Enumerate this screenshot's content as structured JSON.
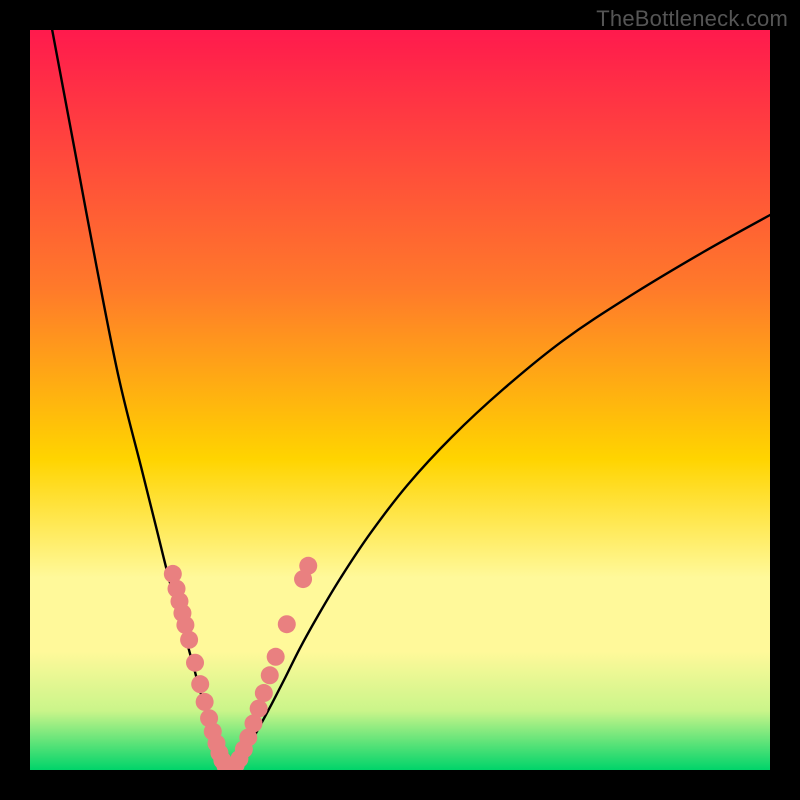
{
  "watermark": "TheBottleneck.com",
  "chart_data": {
    "type": "line",
    "title": "",
    "xlabel": "",
    "ylabel": "",
    "xlim": [
      0,
      100
    ],
    "ylim": [
      0,
      100
    ],
    "gradient_stops": [
      {
        "offset": 0,
        "color": "#ff1a4d"
      },
      {
        "offset": 35,
        "color": "#ff7a2a"
      },
      {
        "offset": 58,
        "color": "#ffd400"
      },
      {
        "offset": 74,
        "color": "#fff99a"
      },
      {
        "offset": 84,
        "color": "#fff99a"
      },
      {
        "offset": 92,
        "color": "#caf58a"
      },
      {
        "offset": 100,
        "color": "#00d46a"
      }
    ],
    "series": [
      {
        "name": "left-branch",
        "x": [
          3,
          6,
          9,
          12,
          15,
          17,
          19,
          21,
          22.5,
          23.6,
          24.5,
          25.2,
          25.8,
          26.3,
          26.7
        ],
        "y": [
          100,
          84,
          68,
          53,
          41,
          33,
          25,
          18,
          12.5,
          8.5,
          5.5,
          3.4,
          1.9,
          0.9,
          0.3
        ]
      },
      {
        "name": "right-branch",
        "x": [
          27.5,
          28.2,
          29.0,
          30.0,
          31.2,
          32.7,
          34.5,
          36.5,
          39,
          42,
          46,
          51,
          57,
          64,
          72,
          81,
          91,
          100
        ],
        "y": [
          0.4,
          1.1,
          2.3,
          4.0,
          6.2,
          9.0,
          12.5,
          16.5,
          21,
          26,
          32,
          38.5,
          45,
          51.5,
          58,
          64,
          70,
          75
        ]
      }
    ],
    "marker_points": {
      "name": "pink-markers",
      "color": "#e98080",
      "points": [
        {
          "x": 19.3,
          "y": 26.5
        },
        {
          "x": 19.8,
          "y": 24.5
        },
        {
          "x": 20.2,
          "y": 22.8
        },
        {
          "x": 20.6,
          "y": 21.2
        },
        {
          "x": 21.0,
          "y": 19.6
        },
        {
          "x": 21.5,
          "y": 17.6
        },
        {
          "x": 22.3,
          "y": 14.5
        },
        {
          "x": 23.0,
          "y": 11.6
        },
        {
          "x": 23.6,
          "y": 9.2
        },
        {
          "x": 24.2,
          "y": 7.0
        },
        {
          "x": 24.7,
          "y": 5.2
        },
        {
          "x": 25.2,
          "y": 3.6
        },
        {
          "x": 25.6,
          "y": 2.3
        },
        {
          "x": 26.0,
          "y": 1.3
        },
        {
          "x": 26.4,
          "y": 0.6
        },
        {
          "x": 26.8,
          "y": 0.25
        },
        {
          "x": 27.3,
          "y": 0.25
        },
        {
          "x": 27.8,
          "y": 0.7
        },
        {
          "x": 28.3,
          "y": 1.5
        },
        {
          "x": 28.9,
          "y": 2.8
        },
        {
          "x": 29.5,
          "y": 4.4
        },
        {
          "x": 30.2,
          "y": 6.3
        },
        {
          "x": 30.9,
          "y": 8.3
        },
        {
          "x": 31.6,
          "y": 10.4
        },
        {
          "x": 32.4,
          "y": 12.8
        },
        {
          "x": 33.2,
          "y": 15.3
        },
        {
          "x": 34.7,
          "y": 19.7
        },
        {
          "x": 36.9,
          "y": 25.8
        },
        {
          "x": 37.6,
          "y": 27.6
        }
      ]
    }
  }
}
